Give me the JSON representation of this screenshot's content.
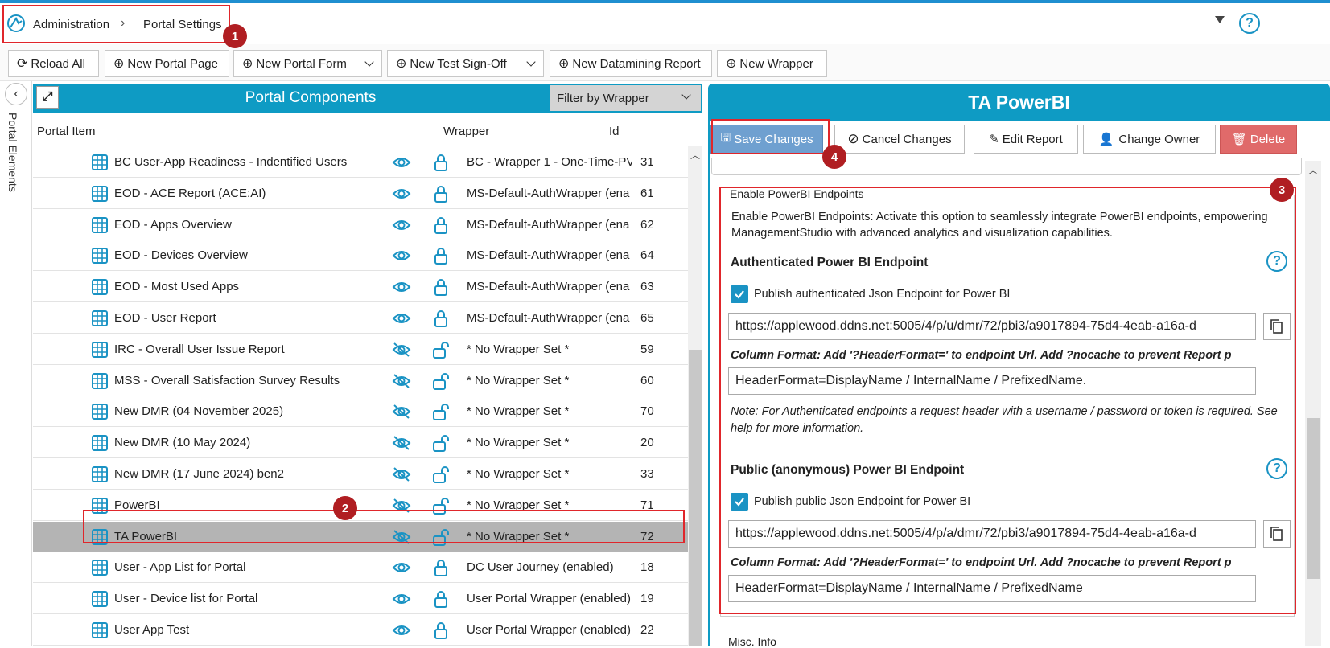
{
  "breadcrumb": {
    "root": "Administration",
    "current": "Portal Settings"
  },
  "help_glyph": "?",
  "toolbar": {
    "reload": "Reload All",
    "new_page": "New Portal Page",
    "new_form": "New Portal Form",
    "new_test": "New Test Sign-Off",
    "new_datamining": "New Datamining Report",
    "new_wrapper": "New Wrapper"
  },
  "side_tab": "Portal Elements",
  "components": {
    "title": "Portal Components",
    "filter": "Filter by Wrapper",
    "columns": {
      "item": "Portal Item",
      "wrapper": "Wrapper",
      "id": "Id"
    },
    "rows": [
      {
        "name": "BC User-App Readiness - Indentified Users",
        "wrapper": "BC - Wrapper 1 - One-Time-PV",
        "id": "31",
        "visible": true,
        "locked": true
      },
      {
        "name": "EOD - ACE Report (ACE:AI)",
        "wrapper": "MS-Default-AuthWrapper (ena",
        "id": "61",
        "visible": true,
        "locked": true
      },
      {
        "name": "EOD - Apps Overview",
        "wrapper": "MS-Default-AuthWrapper (ena",
        "id": "62",
        "visible": true,
        "locked": true
      },
      {
        "name": "EOD - Devices Overview",
        "wrapper": "MS-Default-AuthWrapper (ena",
        "id": "64",
        "visible": true,
        "locked": true
      },
      {
        "name": "EOD - Most Used Apps",
        "wrapper": "MS-Default-AuthWrapper (ena",
        "id": "63",
        "visible": true,
        "locked": true
      },
      {
        "name": "EOD - User Report",
        "wrapper": "MS-Default-AuthWrapper (ena",
        "id": "65",
        "visible": true,
        "locked": true
      },
      {
        "name": "IRC - Overall User Issue Report",
        "wrapper": "* No Wrapper Set *",
        "id": "59",
        "visible": false,
        "locked": false
      },
      {
        "name": "MSS - Overall Satisfaction Survey Results",
        "wrapper": "* No Wrapper Set *",
        "id": "60",
        "visible": false,
        "locked": false
      },
      {
        "name": "New DMR (04 November 2025)",
        "wrapper": "* No Wrapper Set *",
        "id": "70",
        "visible": false,
        "locked": false
      },
      {
        "name": "New DMR (10 May 2024)",
        "wrapper": "* No Wrapper Set *",
        "id": "20",
        "visible": false,
        "locked": false
      },
      {
        "name": "New DMR (17 June 2024) ben2",
        "wrapper": "* No Wrapper Set *",
        "id": "33",
        "visible": false,
        "locked": false
      },
      {
        "name": "PowerBI",
        "wrapper": "* No Wrapper Set *",
        "id": "71",
        "visible": false,
        "locked": false
      },
      {
        "name": "TA PowerBI",
        "wrapper": "* No Wrapper Set *",
        "id": "72",
        "visible": false,
        "locked": false,
        "selected": true
      },
      {
        "name": "User - App List for Portal",
        "wrapper": "DC User Journey (enabled)",
        "id": "18",
        "visible": true,
        "locked": true
      },
      {
        "name": "User - Device list for Portal",
        "wrapper": "User Portal Wrapper (enabled)",
        "id": "19",
        "visible": true,
        "locked": true
      },
      {
        "name": "User App Test",
        "wrapper": "User Portal Wrapper (enabled)",
        "id": "22",
        "visible": true,
        "locked": true
      }
    ]
  },
  "detail": {
    "title": "TA PowerBI",
    "buttons": {
      "save": "Save Changes",
      "cancel": "Cancel Changes",
      "edit": "Edit Report",
      "owner": "Change Owner",
      "delete": "Delete"
    },
    "section_legend": "Enable PowerBI Endpoints",
    "section_desc": "Enable PowerBI Endpoints: Activate this option to seamlessly integrate PowerBI endpoints, empowering ManagementStudio with advanced analytics and visualization capabilities.",
    "auth": {
      "heading": "Authenticated Power BI Endpoint",
      "checkbox": "Publish authenticated Json Endpoint for Power BI",
      "url": "https://applewood.ddns.net:5005/4/p/u/dmr/72/pbi3/a9017894-75d4-4eab-a16a-d",
      "col_format": "Column Format: Add '?HeaderFormat=' to endpoint Url. Add ?nocache to prevent Report p",
      "header_format": "HeaderFormat=DisplayName / InternalName / PrefixedName.",
      "note": "Note: For Authenticated endpoints a request header with a username / password or token is required. See help for more information."
    },
    "public": {
      "heading": "Public (anonymous) Power BI Endpoint",
      "checkbox": "Publish public Json Endpoint for Power BI",
      "url": "https://applewood.ddns.net:5005/4/p/a/dmr/72/pbi3/a9017894-75d4-4eab-a16a-d",
      "col_format": "Column Format: Add '?HeaderFormat=' to endpoint Url. Add ?nocache to prevent Report p",
      "header_format": "HeaderFormat=DisplayName / InternalName / PrefixedName"
    },
    "misc": "Misc. Info"
  },
  "annotations": [
    "1",
    "2",
    "3",
    "4"
  ],
  "colors": {
    "accent": "#0e9bc4",
    "highlight": "#e0262b",
    "badge": "#b01e22"
  }
}
